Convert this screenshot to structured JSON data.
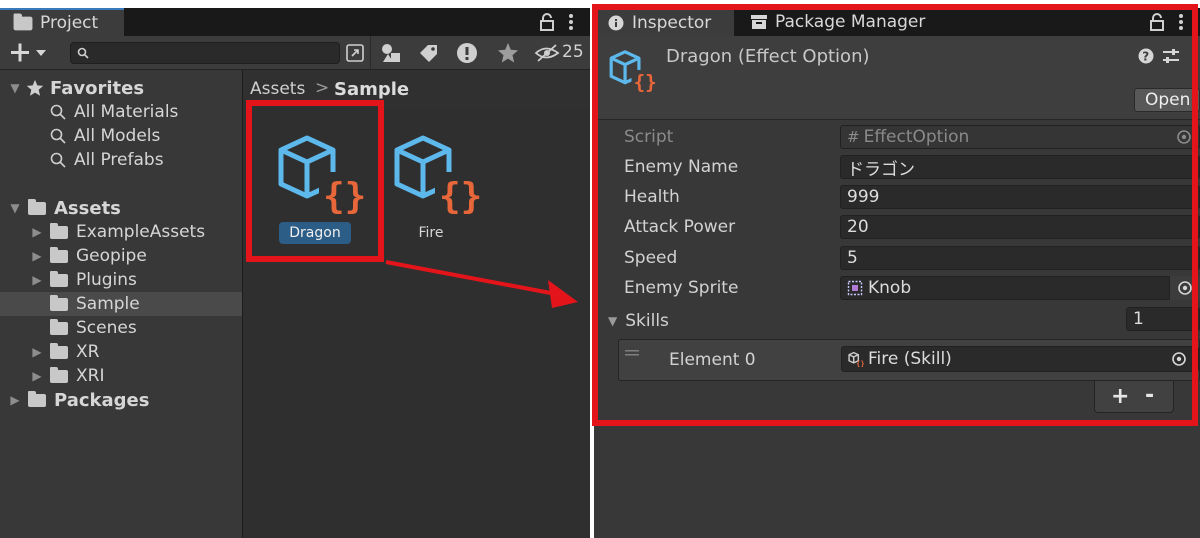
{
  "project": {
    "tab_label": "Project",
    "hidden_count": "25",
    "favorites": {
      "label": "Favorites",
      "items": [
        "All Materials",
        "All Models",
        "All Prefabs"
      ]
    },
    "assets": {
      "label": "Assets",
      "folders": [
        "ExampleAssets",
        "Geopipe",
        "Plugins",
        "Sample",
        "Scenes",
        "XR",
        "XRI"
      ],
      "selected": "Sample"
    },
    "packages_label": "Packages",
    "breadcrumb": {
      "root": "Assets",
      "separator": ">",
      "current": "Sample"
    },
    "asset_items": [
      {
        "name": "Dragon",
        "selected": true
      },
      {
        "name": "Fire",
        "selected": false
      }
    ]
  },
  "inspector": {
    "tab_label": "Inspector",
    "package_tab_label": "Package Manager",
    "header_title": "Dragon (Effect Option)",
    "open_button": "Open",
    "properties": {
      "script": {
        "label": "Script",
        "value": "EffectOption"
      },
      "enemy_name": {
        "label": "Enemy Name",
        "value": "ドラゴン"
      },
      "health": {
        "label": "Health",
        "value": "999"
      },
      "attack_power": {
        "label": "Attack Power",
        "value": "20"
      },
      "speed": {
        "label": "Speed",
        "value": "5"
      },
      "enemy_sprite": {
        "label": "Enemy Sprite",
        "value": "Knob"
      }
    },
    "skills": {
      "label": "Skills",
      "count": "1",
      "elements": [
        {
          "label": "Element 0",
          "value": "Fire (Skill)"
        }
      ],
      "add_label": "+",
      "remove_label": "-"
    }
  },
  "colors": {
    "annotation_red": "#e4141b",
    "selection_blue": "#2c5d87",
    "asset_icon_blue": "#5db8ec",
    "asset_icon_orange": "#e8673a",
    "panel_dark": "#282828",
    "panel_mid": "#383838"
  },
  "icons": [
    "folder-icon",
    "search-icon",
    "lock-icon",
    "kebab-menu-icon",
    "star-icon",
    "info-icon",
    "package-icon",
    "help-icon",
    "settings-icon",
    "target-icon",
    "scriptable-object-icon",
    "sprite-icon",
    "drag-handle-icon"
  ]
}
